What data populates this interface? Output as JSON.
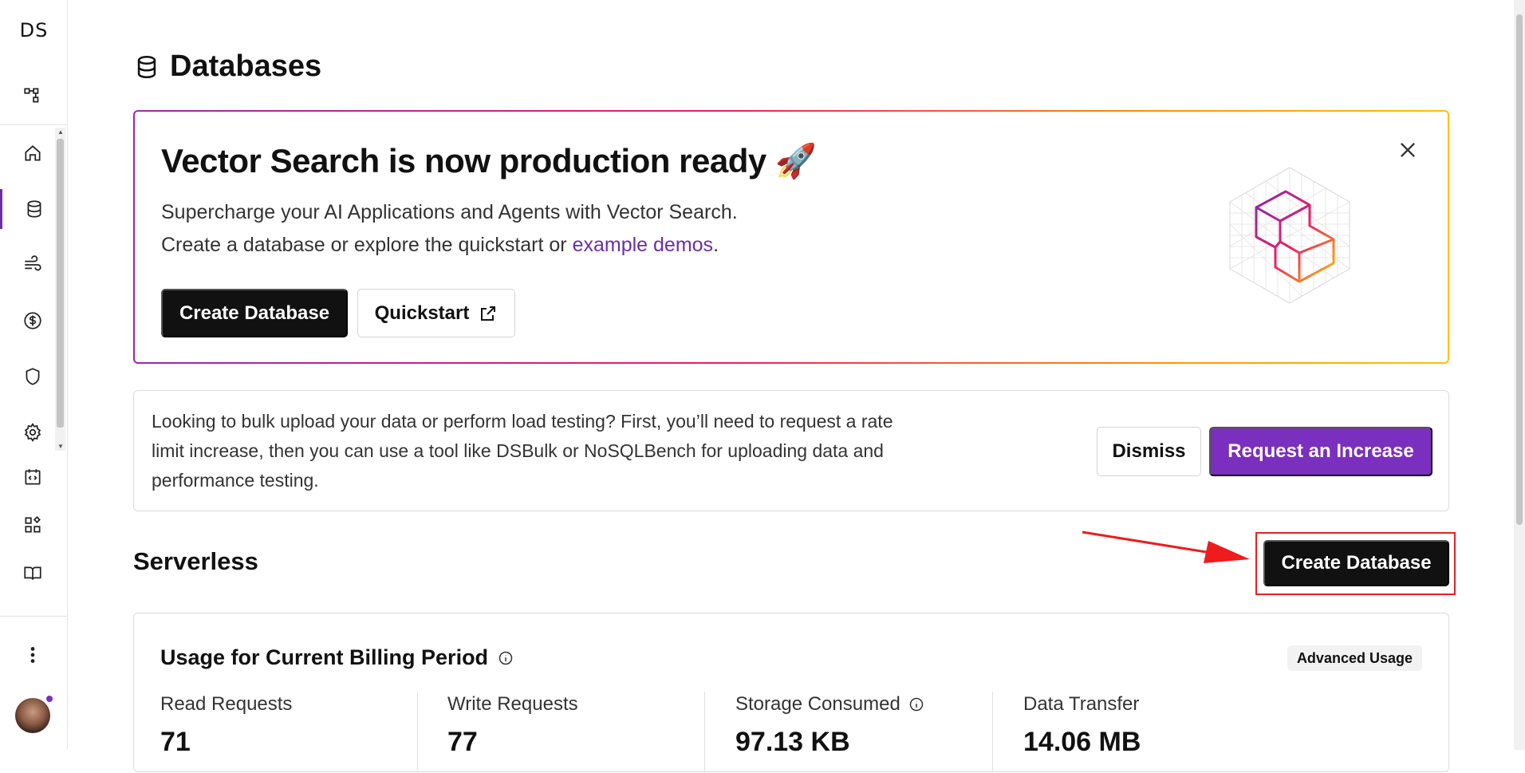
{
  "sidebar": {
    "logo": "DS",
    "items": [
      {
        "icon": "org-structure-icon"
      },
      {
        "icon": "home-icon"
      },
      {
        "icon": "databases-icon",
        "active": true
      },
      {
        "icon": "streaming-icon"
      },
      {
        "icon": "billing-icon"
      },
      {
        "icon": "security-shield-icon"
      },
      {
        "icon": "settings-gear-icon"
      },
      {
        "icon": "api-code-icon"
      },
      {
        "icon": "integrations-icon"
      },
      {
        "icon": "docs-book-icon"
      },
      {
        "icon": "more-menu-icon"
      }
    ]
  },
  "page": {
    "title": "Databases"
  },
  "promo": {
    "title": "Vector Search is now production ready 🚀",
    "line1": "Supercharge your AI Applications and Agents with Vector Search.",
    "line2_prefix": "Create a database or explore the quickstart or ",
    "line2_link": "example demos",
    "line2_suffix": ".",
    "create_label": "Create Database",
    "quickstart_label": "Quickstart"
  },
  "notice": {
    "text": "Looking to bulk upload your data or perform load testing? First, you’ll need to request a rate limit increase, then you can use a tool like DSBulk or NoSQLBench for uploading data and performance testing.",
    "dismiss_label": "Dismiss",
    "request_label": "Request an Increase"
  },
  "serverless": {
    "title": "Serverless",
    "create_label": "Create Database"
  },
  "usage": {
    "title": "Usage for Current Billing Period",
    "advanced_label": "Advanced Usage",
    "stats": [
      {
        "label": "Read Requests",
        "value": "71"
      },
      {
        "label": "Write Requests",
        "value": "77"
      },
      {
        "label": "Storage Consumed",
        "value": "97.13 KB"
      },
      {
        "label": "Data Transfer",
        "value": "14.06 MB"
      }
    ]
  },
  "colors": {
    "accent": "#7b2fbe",
    "primary_button": "#111111",
    "annotation": "#e82020"
  }
}
